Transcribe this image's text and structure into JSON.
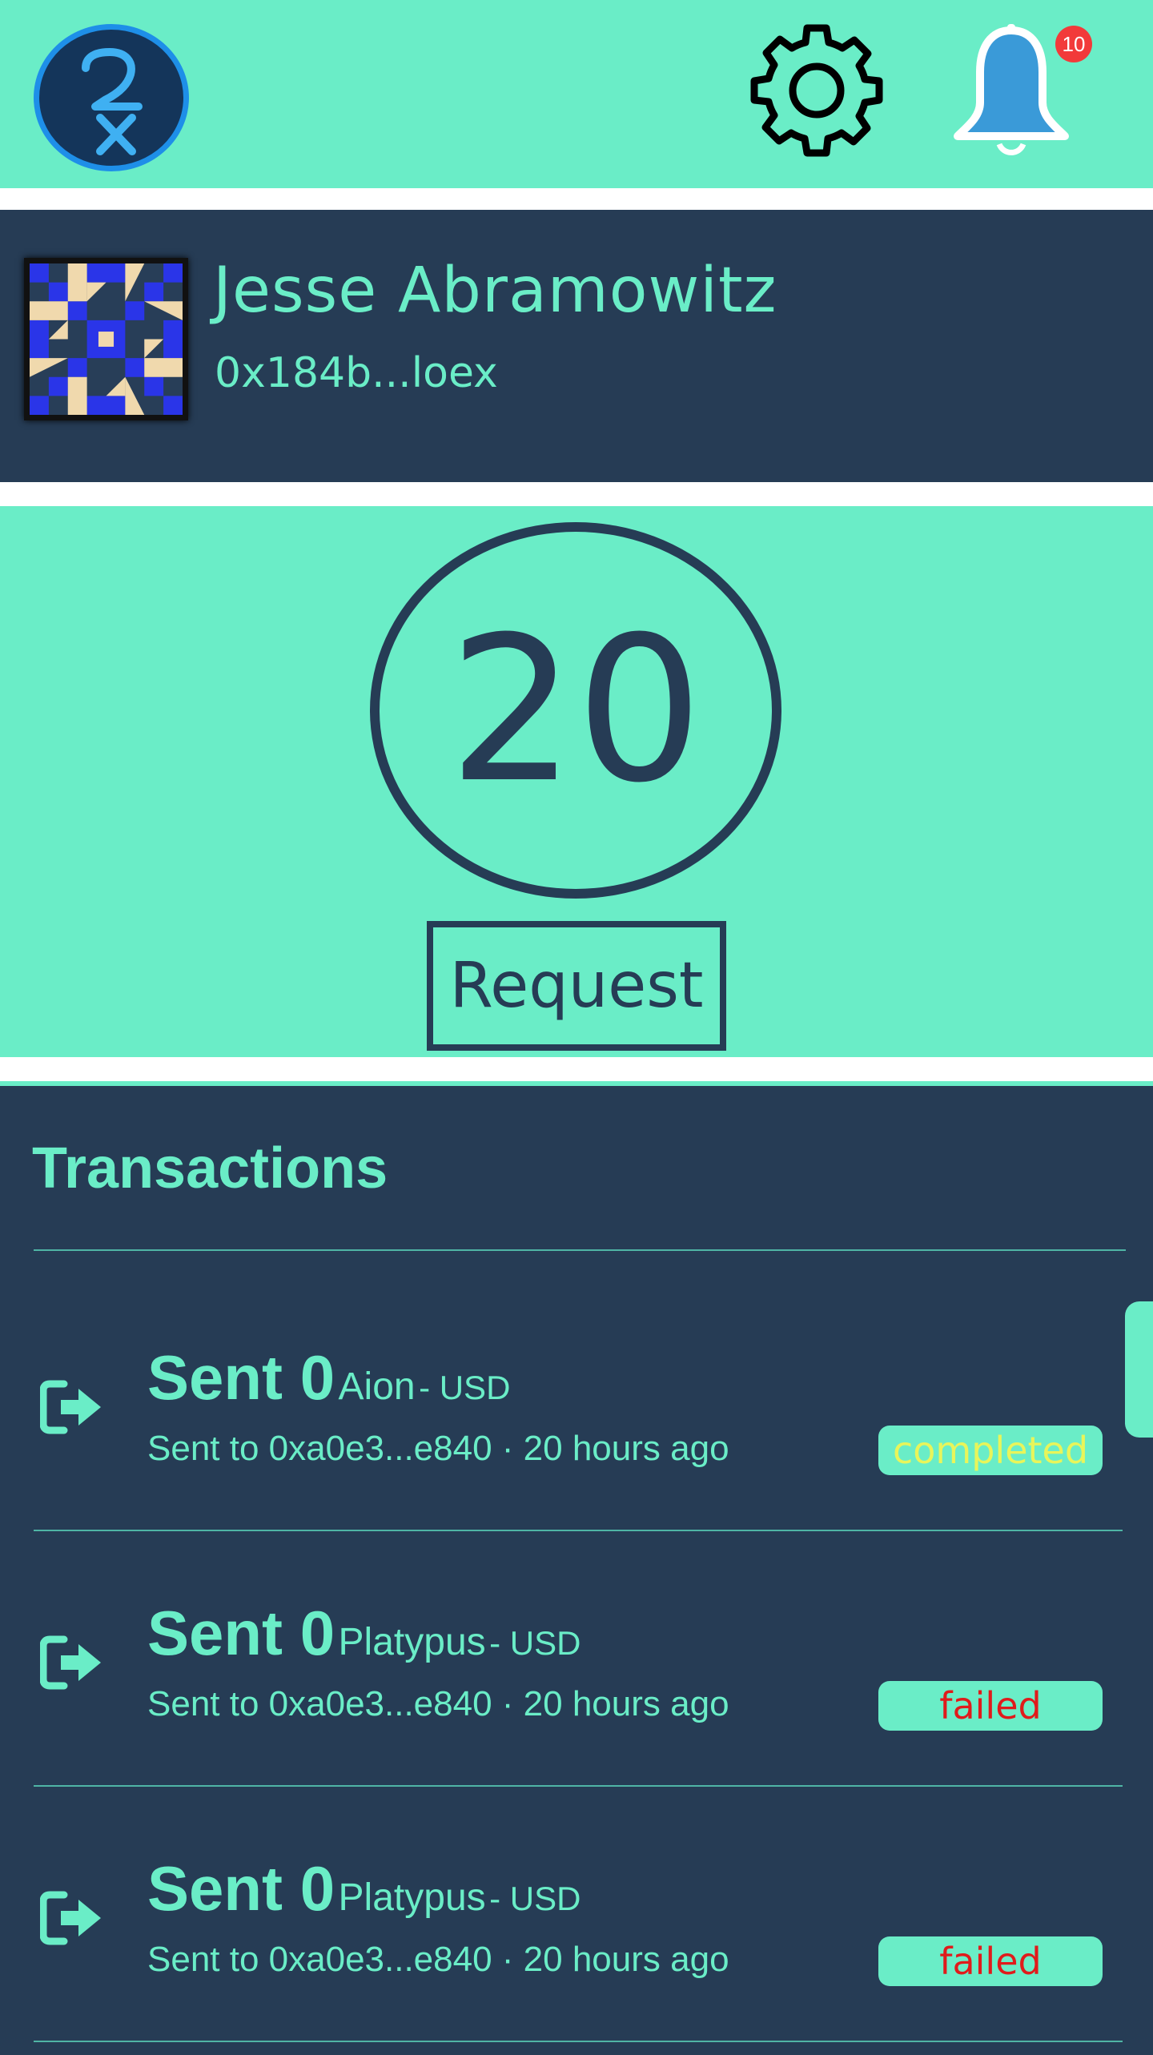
{
  "header": {
    "notification_count": "10"
  },
  "profile": {
    "name": "Jesse Abramowitz",
    "address": "0x184b...loex"
  },
  "balance": {
    "value": "20",
    "request_label": "Request"
  },
  "transactions": {
    "title": "Transactions",
    "items": [
      {
        "sent_label": "Sent 0",
        "coin": "Aion",
        "currency": "- USD",
        "subtitle": "Sent to 0xa0e3...e840 · 20 hours ago",
        "status": "completed",
        "status_color": "#e8f55a"
      },
      {
        "sent_label": "Sent 0",
        "coin": "Platypus",
        "currency": "- USD",
        "subtitle": "Sent to 0xa0e3...e840 · 20 hours ago",
        "status": "failed",
        "status_color": "#e01b1b"
      },
      {
        "sent_label": "Sent 0",
        "coin": "Platypus",
        "currency": "- USD",
        "subtitle": "Sent to 0xa0e3...e840 · 20 hours ago",
        "status": "failed",
        "status_color": "#e01b1b"
      }
    ]
  },
  "colors": {
    "accent": "#6aedc7",
    "dark": "#263c55",
    "logo_ring": "#1e8fe8"
  },
  "icons": [
    "rx-logo-icon",
    "gear-icon",
    "bell-icon",
    "sign-out-icon"
  ]
}
